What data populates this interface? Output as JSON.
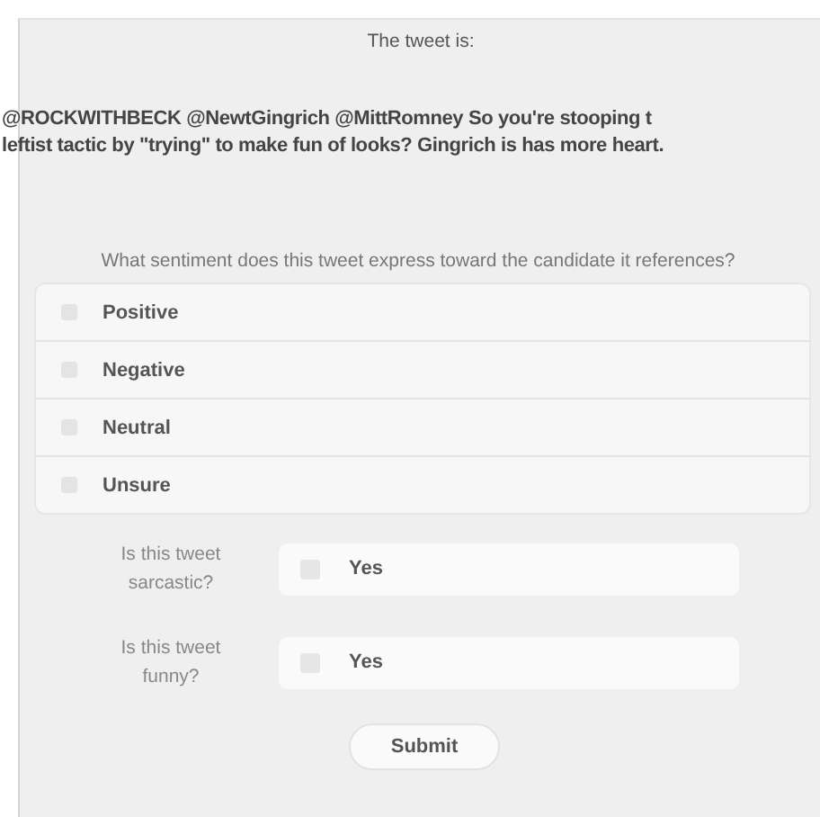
{
  "heading": "The tweet is:",
  "tweet_lines": [
    "@ROCKWITHBECK @NewtGingrich @MittRomney So you're stooping t",
    "leftist tactic by \"trying\" to make fun of looks? Gingrich is has more heart."
  ],
  "question": "What sentiment does this tweet express toward the candidate it references?",
  "options": [
    {
      "label": "Positive",
      "selected": false
    },
    {
      "label": "Negative",
      "selected": false
    },
    {
      "label": "Neutral",
      "selected": false
    },
    {
      "label": "Unsure",
      "selected": false
    }
  ],
  "checks": [
    {
      "question": "Is this tweet sarcastic?",
      "label": "Yes",
      "checked": false
    },
    {
      "question": "Is this tweet funny?",
      "label": "Yes",
      "checked": false
    }
  ],
  "submit": "Submit"
}
